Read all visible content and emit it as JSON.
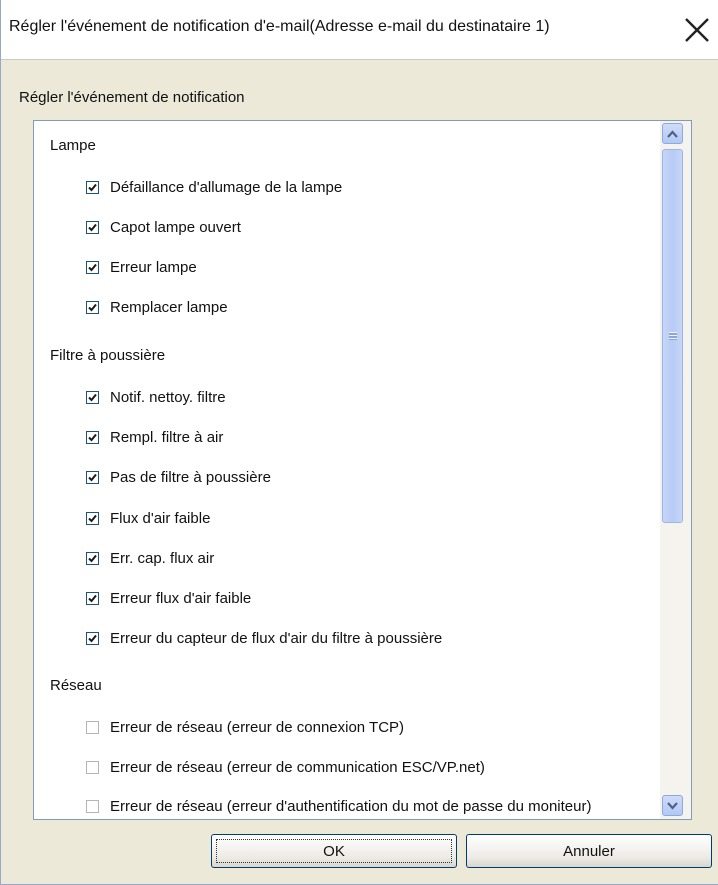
{
  "window": {
    "title": "Régler l'événement de notification d'e-mail(Adresse e-mail du destinataire 1)",
    "close_icon": "close-x-icon"
  },
  "section_label": "Régler l'événement de notification",
  "categories": [
    {
      "label": "Lampe",
      "items": [
        {
          "label": "Défaillance d'allumage de la lampe",
          "checked": true
        },
        {
          "label": "Capot lampe ouvert",
          "checked": true
        },
        {
          "label": "Erreur lampe",
          "checked": true
        },
        {
          "label": "Remplacer lampe",
          "checked": true
        }
      ]
    },
    {
      "label": "Filtre à poussière",
      "items": [
        {
          "label": "Notif. nettoy. filtre",
          "checked": true
        },
        {
          "label": "Rempl. filtre à air",
          "checked": true
        },
        {
          "label": "Pas de filtre à poussière",
          "checked": true
        },
        {
          "label": "Flux d'air faible",
          "checked": true
        },
        {
          "label": "Err. cap. flux air",
          "checked": true
        },
        {
          "label": "Erreur flux d'air faible",
          "checked": true
        },
        {
          "label": "Erreur du capteur de flux d'air du filtre à poussière",
          "checked": true
        }
      ]
    },
    {
      "label": "Réseau",
      "items": [
        {
          "label": "Erreur de réseau (erreur de connexion TCP)",
          "checked": false
        },
        {
          "label": "Erreur de réseau (erreur de communication ESC/VP.net)",
          "checked": false
        },
        {
          "label": "Erreur de réseau (erreur d'authentification du mot de passe du moniteur)",
          "checked": false
        }
      ]
    }
  ],
  "buttons": {
    "ok_label": "OK",
    "cancel_label": "Annuler"
  }
}
